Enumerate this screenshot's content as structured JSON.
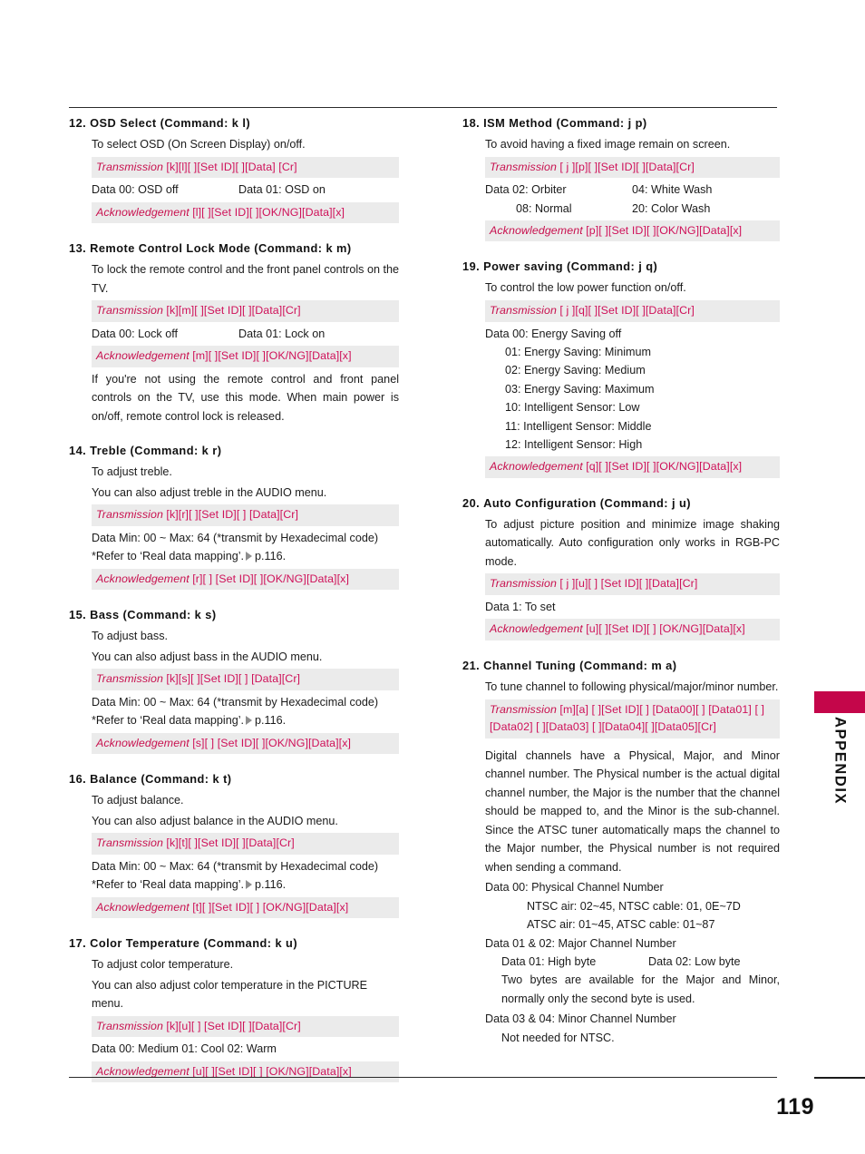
{
  "page": {
    "number": "119",
    "tab_label": "APPENDIX",
    "accent_color": "#c4064a",
    "command_text_color": "#c8104e",
    "command_bar_background": "#ebebeb"
  },
  "left_column": [
    {
      "number": "12.",
      "title": "OSD Select (Command: k l)",
      "lines": [
        {
          "kind": "para",
          "text": "To select OSD (On Screen Display) on/off."
        },
        {
          "kind": "cmd",
          "label": "Transmission",
          "code": "[k][l][  ][Set ID][  ][Data] [Cr]"
        },
        {
          "kind": "two",
          "c1": "Data 00: OSD off",
          "c2": "Data 01: OSD on"
        },
        {
          "kind": "cmd",
          "label": "Acknowledgement",
          "code": "[l][  ][Set ID][  ][OK/NG][Data][x]"
        }
      ]
    },
    {
      "number": "13.",
      "title": "Remote Control Lock Mode (Command: k m)",
      "lines": [
        {
          "kind": "para_justify",
          "text": "To lock the remote control and the front panel controls on the TV."
        },
        {
          "kind": "cmd",
          "label": "Transmission",
          "code": "[k][m][  ][Set ID][  ][Data][Cr]"
        },
        {
          "kind": "two",
          "c1": "Data 00: Lock off",
          "c2": "Data 01: Lock on"
        },
        {
          "kind": "cmd",
          "label": "Acknowledgement",
          "code": "[m][  ][Set ID][  ][OK/NG][Data][x]"
        },
        {
          "kind": "para_justify",
          "text": "If you're not using the remote control and front panel controls on the TV, use this mode. When main power is on/off, remote control lock is released."
        }
      ]
    },
    {
      "number": "14.",
      "title": "Treble (Command: k r)",
      "lines": [
        {
          "kind": "para",
          "text": "To adjust treble."
        },
        {
          "kind": "para",
          "text": "You can also adjust treble in the AUDIO menu."
        },
        {
          "kind": "cmd",
          "label": "Transmission",
          "code": "[k][r][  ][Set ID][  ] [Data][Cr]"
        },
        {
          "kind": "data",
          "text": "Data Min: 00 ~ Max: 64 (*transmit by Hexadecimal code)"
        },
        {
          "kind": "note",
          "pre": "*Refer to ‘Real data mapping’.",
          "post": "p.116."
        },
        {
          "kind": "cmd",
          "label": "Acknowledgement",
          "code": "[r][  ] [Set ID][  ][OK/NG][Data][x]"
        }
      ]
    },
    {
      "number": "15.",
      "title": "Bass (Command: k s)",
      "lines": [
        {
          "kind": "para",
          "text": "To adjust bass."
        },
        {
          "kind": "para",
          "text": "You can also adjust bass in the AUDIO menu."
        },
        {
          "kind": "cmd",
          "label": "Transmission",
          "code": "[k][s][  ][Set ID][  ] [Data][Cr]"
        },
        {
          "kind": "data",
          "text": "Data Min: 00 ~ Max: 64 (*transmit by Hexadecimal code)"
        },
        {
          "kind": "note",
          "pre": "*Refer to ‘Real data mapping’.",
          "post": "p.116."
        },
        {
          "kind": "cmd",
          "label": "Acknowledgement",
          "code": "[s][  ] [Set ID][  ][OK/NG][Data][x]"
        }
      ]
    },
    {
      "number": "16.",
      "title": "Balance (Command: k t)",
      "lines": [
        {
          "kind": "para",
          "text": "To adjust balance."
        },
        {
          "kind": "para",
          "text": "You can also adjust balance in the AUDIO menu."
        },
        {
          "kind": "cmd",
          "label": "Transmission",
          "code": "[k][t][  ][Set ID][  ][Data][Cr]"
        },
        {
          "kind": "data",
          "text": "Data Min: 00 ~ Max: 64 (*transmit by Hexadecimal code)"
        },
        {
          "kind": "note",
          "pre": "*Refer to ‘Real data mapping’.",
          "post": "p.116."
        },
        {
          "kind": "cmd",
          "label": "Acknowledgement",
          "code": "[t][  ][Set ID][  ] [OK/NG][Data][x]"
        }
      ]
    },
    {
      "number": "17.",
      "title": "Color Temperature (Command: k u)",
      "lines": [
        {
          "kind": "para",
          "text": "To adjust color temperature."
        },
        {
          "kind": "para",
          "text": "You can also adjust color temperature in the PICTURE menu."
        },
        {
          "kind": "cmd",
          "label": "Transmission",
          "code": "[k][u][  ] [Set ID][  ][Data][Cr]"
        },
        {
          "kind": "data",
          "text": "Data 00: Medium   01: Cool   02: Warm"
        },
        {
          "kind": "cmd",
          "label": "Acknowledgement",
          "code": "[u][  ][Set ID][  ] [OK/NG][Data][x]"
        }
      ]
    }
  ],
  "right_column": [
    {
      "number": "18.",
      "title": "ISM Method (Command: j p)",
      "lines": [
        {
          "kind": "para",
          "text": "To avoid having a fixed image remain on screen."
        },
        {
          "kind": "cmd",
          "label": "Transmission",
          "code": "[ j ][p][  ][Set ID][  ][Data][Cr]"
        },
        {
          "kind": "two",
          "c1": "Data 02: Orbiter",
          "c2": "04: White Wash"
        },
        {
          "kind": "two_indent",
          "c1": "08: Normal",
          "c2": "20: Color Wash"
        },
        {
          "kind": "cmd",
          "label": "Acknowledgement",
          "code": "[p][  ][Set ID][  ][OK/NG][Data][x]"
        }
      ]
    },
    {
      "number": "19.",
      "title": "Power saving (Command: j q)",
      "lines": [
        {
          "kind": "para",
          "text": "To control the low power function on/off."
        },
        {
          "kind": "cmd",
          "label": "Transmission",
          "code": "[ j ][q][  ][Set ID][  ][Data][Cr]"
        },
        {
          "kind": "data",
          "text": "Data 00: Energy Saving off"
        },
        {
          "kind": "data_indent",
          "text": "01: Energy Saving: Minimum"
        },
        {
          "kind": "data_indent",
          "text": "02: Energy Saving: Medium"
        },
        {
          "kind": "data_indent",
          "text": "03: Energy Saving: Maximum"
        },
        {
          "kind": "data_indent",
          "text": "10: Intelligent Sensor: Low"
        },
        {
          "kind": "data_indent",
          "text": "11: Intelligent Sensor: Middle"
        },
        {
          "kind": "data_indent",
          "text": "12: Intelligent Sensor: High"
        },
        {
          "kind": "cmd",
          "label": "Acknowledgement",
          "code": "[q][  ][Set ID][  ][OK/NG][Data][x]"
        }
      ]
    },
    {
      "number": "20.",
      "title": "Auto Configuration (Command: j u)",
      "lines": [
        {
          "kind": "para_justify",
          "text": "To adjust picture position and minimize image shaking automatically. Auto configuration only works in RGB-PC mode."
        },
        {
          "kind": "cmd",
          "label": "Transmission",
          "code": "[ j ][u][  ] [Set ID][  ][Data][Cr]"
        },
        {
          "kind": "data",
          "text": "Data 1: To set"
        },
        {
          "kind": "cmd",
          "label": "Acknowledgement",
          "code": "[u][  ][Set ID][  ] [OK/NG][Data][x]"
        }
      ]
    },
    {
      "number": "21.",
      "title": "Channel Tuning (Command: m a)",
      "lines": [
        {
          "kind": "para",
          "text": "To tune channel to following physical/major/minor number."
        },
        {
          "kind": "cmd_wrap",
          "label": "Transmission",
          "code": "[m][a] [  ][Set ID][  ] [Data00][  ] [Data01] [  ][Data02] [  ][Data03] [  ][Data04][  ][Data05][Cr]"
        },
        {
          "kind": "spacer"
        },
        {
          "kind": "para_justify",
          "text": "Digital channels have a Physical, Major, and Minor channel number. The Physical number is the actual digital channel number, the Major is the number that the channel should be mapped to, and the Minor is the sub-channel. Since the ATSC tuner automatically maps the channel to the Major number, the Physical number is not required when sending a command."
        },
        {
          "kind": "data",
          "text": "Data 00: Physical Channel Number"
        },
        {
          "kind": "data_indent2",
          "text": "NTSC air: 02~45, NTSC cable: 01, 0E~7D"
        },
        {
          "kind": "data_indent2",
          "text": "ATSC air: 01~45, ATSC cable: 01~87"
        },
        {
          "kind": "data",
          "text": "Data 01 & 02: Major Channel Number"
        },
        {
          "kind": "two_indent3",
          "c1": "Data 01: High byte",
          "c2": "Data 02: Low byte"
        },
        {
          "kind": "para_justify_indent",
          "text": "Two bytes are available for the Major and Minor, normally only the second byte is used."
        },
        {
          "kind": "data",
          "text": "Data 03 & 04: Minor Channel Number"
        },
        {
          "kind": "data_indent3",
          "text": "Not needed for NTSC."
        }
      ]
    }
  ]
}
